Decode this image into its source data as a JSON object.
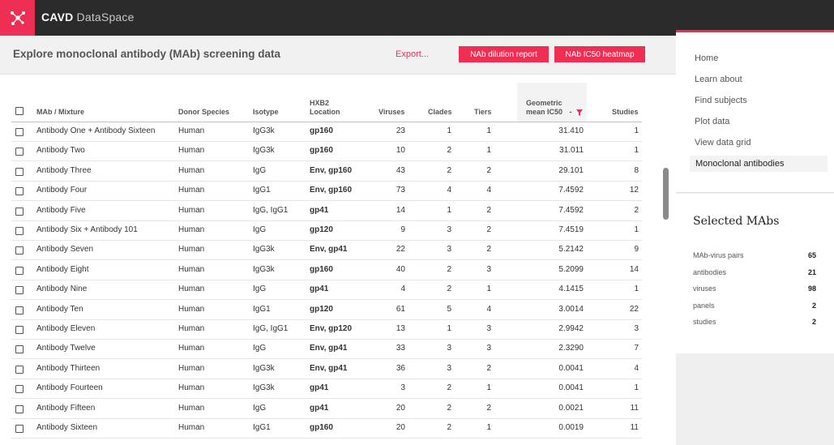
{
  "app": {
    "name_bold": "CAVD",
    "name_light": "DataSpace"
  },
  "header": {
    "title": "Explore monoclonal antibody (MAb) screening data",
    "export_label": "Export...",
    "dilution_report_label": "NAb dilution report",
    "heatmap_label": "NAb IC50 heatmap"
  },
  "table": {
    "columns": {
      "name": "MAb / Mixture",
      "species": "Donor Species",
      "isotype": "Isotype",
      "hxb2_line1": "HXB2",
      "hxb2_line2": "Location",
      "viruses": "Viruses",
      "clades": "Clades",
      "tiers": "Tiers",
      "ic50_line1": "Geometric",
      "ic50_line2": "mean IC50",
      "ic50_sort": "-",
      "studies": "Studies"
    },
    "rows": [
      {
        "name": "Antibody One + Antibody Sixteen",
        "species": "Human",
        "isotype": "IgG3k",
        "location": "gp160",
        "viruses": "23",
        "clades": "1",
        "tiers": "1",
        "ic50": "31.410",
        "studies": "1"
      },
      {
        "name": "Antibody Two",
        "species": "Human",
        "isotype": "IgG3k",
        "location": "gp160",
        "viruses": "10",
        "clades": "2",
        "tiers": "1",
        "ic50": "31.011",
        "studies": "1"
      },
      {
        "name": "Antibody Three",
        "species": "Human",
        "isotype": "IgG",
        "location": "Env, gp160",
        "viruses": "43",
        "clades": "2",
        "tiers": "2",
        "ic50": "29.101",
        "studies": "8"
      },
      {
        "name": "Antibody Four",
        "species": "Human",
        "isotype": "IgG1",
        "location": "Env, gp160",
        "viruses": "73",
        "clades": "4",
        "tiers": "4",
        "ic50": "7.4592",
        "studies": "12"
      },
      {
        "name": "Antibody Five",
        "species": "Human",
        "isotype": "IgG, IgG1",
        "location": "gp41",
        "viruses": "14",
        "clades": "1",
        "tiers": "2",
        "ic50": "7.4592",
        "studies": "2"
      },
      {
        "name": "Antibody Six + Antibody 101",
        "species": "Human",
        "isotype": "IgG",
        "location": "gp120",
        "viruses": "9",
        "clades": "3",
        "tiers": "2",
        "ic50": "7.4519",
        "studies": "1"
      },
      {
        "name": "Antibody Seven",
        "species": "Human",
        "isotype": "IgG3k",
        "location": "Env, gp41",
        "viruses": "22",
        "clades": "3",
        "tiers": "2",
        "ic50": "5.2142",
        "studies": "9"
      },
      {
        "name": "Antibody Eight",
        "species": "Human",
        "isotype": "IgG3k",
        "location": "gp160",
        "viruses": "40",
        "clades": "2",
        "tiers": "3",
        "ic50": "5.2099",
        "studies": "14"
      },
      {
        "name": "Antibody Nine",
        "species": "Human",
        "isotype": "IgG",
        "location": "gp41",
        "viruses": "4",
        "clades": "2",
        "tiers": "1",
        "ic50": "4.1415",
        "studies": "1"
      },
      {
        "name": "Antibody Ten",
        "species": "Human",
        "isotype": "IgG1",
        "location": "gp120",
        "viruses": "61",
        "clades": "5",
        "tiers": "4",
        "ic50": "3.0014",
        "studies": "22"
      },
      {
        "name": "Antibody Eleven",
        "species": "Human",
        "isotype": "IgG, IgG1",
        "location": "Env, gp120",
        "viruses": "13",
        "clades": "1",
        "tiers": "3",
        "ic50": "2.9942",
        "studies": "3"
      },
      {
        "name": "Antibody Twelve",
        "species": "Human",
        "isotype": "IgG",
        "location": "Env, gp41",
        "viruses": "33",
        "clades": "3",
        "tiers": "3",
        "ic50": "2.3290",
        "studies": "7"
      },
      {
        "name": "Antibody Thirteen",
        "species": "Human",
        "isotype": "IgG3k",
        "location": "Env, gp41",
        "viruses": "36",
        "clades": "3",
        "tiers": "2",
        "ic50": "0.0041",
        "studies": "4"
      },
      {
        "name": "Antibody Fourteen",
        "species": "Human",
        "isotype": "IgG3k",
        "location": "gp41",
        "viruses": "3",
        "clades": "2",
        "tiers": "1",
        "ic50": "0.0041",
        "studies": "1"
      },
      {
        "name": "Antibody Fifteen",
        "species": "Human",
        "isotype": "IgG",
        "location": "gp41",
        "viruses": "20",
        "clades": "2",
        "tiers": "2",
        "ic50": "0.0021",
        "studies": "11"
      },
      {
        "name": "Antibody Sixteen",
        "species": "Human",
        "isotype": "IgG1",
        "location": "gp160",
        "viruses": "20",
        "clades": "2",
        "tiers": "1",
        "ic50": "0.0019",
        "studies": "11"
      }
    ]
  },
  "sidebar": {
    "nav": [
      {
        "label": "Home"
      },
      {
        "label": "Learn about"
      },
      {
        "label": "Find subjects"
      },
      {
        "label": "Plot data"
      },
      {
        "label": "View data grid"
      },
      {
        "label": "Monoclonal antibodies"
      }
    ],
    "selected_title": "Selected MAbs",
    "stats": [
      {
        "label": "MAb-virus pairs",
        "value": "65"
      },
      {
        "label": "antibodies",
        "value": "21"
      },
      {
        "label": "viruses",
        "value": "98"
      },
      {
        "label": "panels",
        "value": "2"
      },
      {
        "label": "studies",
        "value": "2"
      }
    ]
  },
  "colors": {
    "accent": "#ee2f53",
    "topbar": "#2b2b2b"
  },
  "icons": {
    "logo": "cavd-logo-icon",
    "sort": "filter-funnel-icon"
  }
}
